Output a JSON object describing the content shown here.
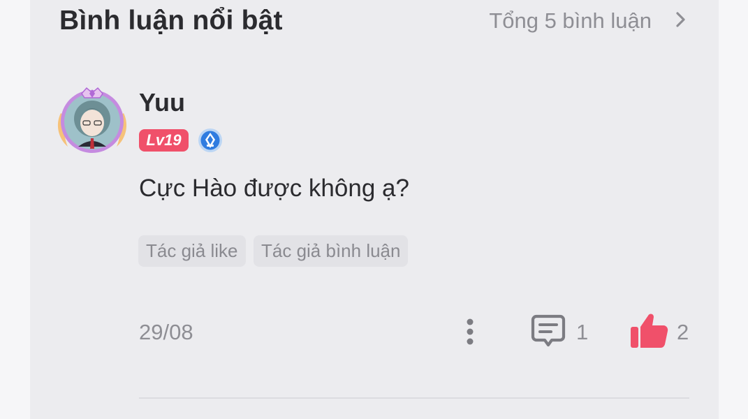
{
  "header": {
    "title": "Bình luận nổi bật",
    "total_label": "Tổng 5 bình luận",
    "chevron_icon": "chevron-right-icon"
  },
  "comment": {
    "avatar_icon": "avatar-with-frame",
    "username": "Yuu",
    "level": "Lv19",
    "level_color": "#f0506a",
    "verified_icon": "verified-badge-icon",
    "verified_color": "#2f7ce0",
    "text": "Cực Hào được không ạ?",
    "tags": [
      "Tác giả like",
      "Tác giả bình luận"
    ],
    "date": "29/08",
    "more_icon": "more-vertical-icon",
    "reply_icon": "comment-icon",
    "reply_count": "1",
    "like_icon": "thumbs-up-icon",
    "like_color": "#f0506a",
    "like_count": "2"
  }
}
